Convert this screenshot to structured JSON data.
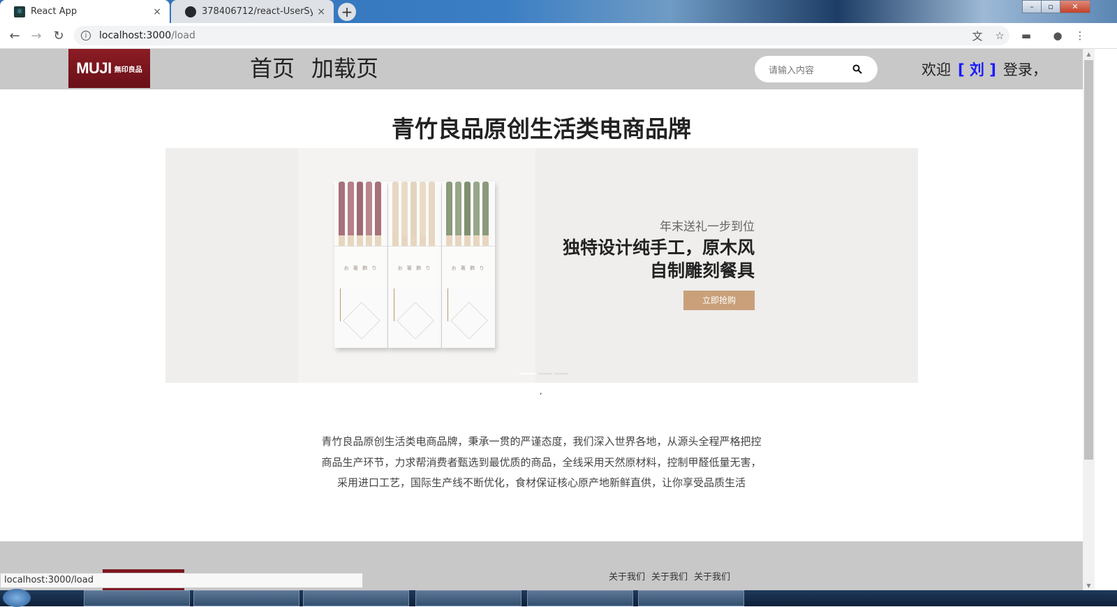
{
  "browser": {
    "tabs": [
      {
        "title": "React App",
        "close": "×",
        "active": true
      },
      {
        "title": "378406712/react-UserSystem",
        "close": "×",
        "active": false
      }
    ],
    "new_tab": "+",
    "url_host": "localhost:3000",
    "url_path": "/load",
    "status_text": "localhost:3000/load"
  },
  "header": {
    "logo_text": "MUJI",
    "logo_sub": "無印良品",
    "nav": [
      "首页",
      "加载页"
    ],
    "search_placeholder": "请输入内容",
    "welcome_prefix": "欢迎",
    "user_name": "[ 刘 ]",
    "welcome_suffix": "登录，"
  },
  "main": {
    "title": "青竹良品原创生活类电商品牌",
    "banner": {
      "subtitle": "年末送礼一步到位",
      "headline_1": "独特设计纯手工，原木风",
      "headline_2": "自制雕刻餐具",
      "button": "立即抢购",
      "box_label": "お 箸 飾 り",
      "slide_count": 3,
      "active_slide": 0
    },
    "separator": ",",
    "description": [
      "青竹良品原创生活类电商品牌，秉承一贯的严谨态度，我们深入世界各地，从源头全程严格把控",
      "商品生产环节，力求帮消费者甄选到最优质的商品，全线采用天然原材料，控制甲醛低量无害，",
      "采用进口工艺，国际生产线不断优化，食材保证核心原产地新鲜直供，让你享受品质生活"
    ]
  },
  "footer": {
    "links": [
      "关于我们",
      "关于我们",
      "关于我们"
    ]
  },
  "colors": {
    "header_bg": "#c8c8c8",
    "logo_bg": "#8b1c24",
    "accent_user": "#1a1aff",
    "buy_button": "#c9a07a"
  }
}
